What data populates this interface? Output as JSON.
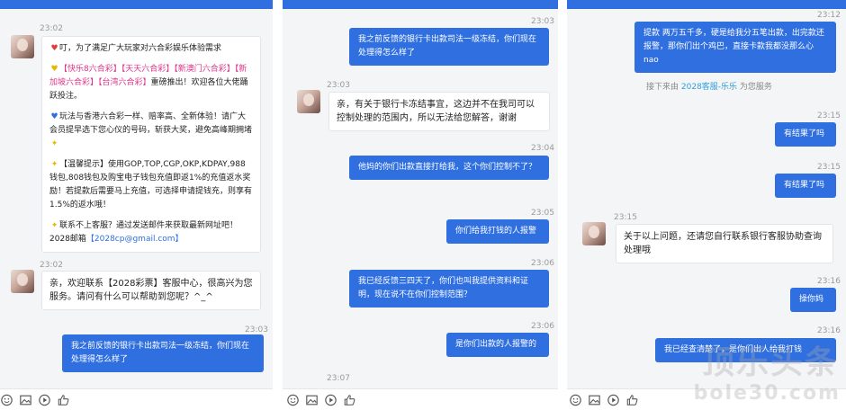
{
  "panel1": {
    "ts1": "23:02",
    "promo": {
      "line1": "叮，为了满足广大玩家对六合彩娱乐体验需求",
      "products_a": "【快乐8六合彩】【天天六合彩】【新澳门六合彩】",
      "products_b": "【新加坡六合彩】【台湾六合彩】",
      "line2_tail": "重磅推出！欢迎各位大佬踊跃投注。",
      "line3": "玩法与香港六合彩一样、赔率高、全新体验！请广大会员提早选下您心仪的号码，斩获大奖，避免高峰期拥堵",
      "line4": "【温馨提示】使用GOP,TOP,CGP,OKP,KDPAY,988钱包,808钱包及购宝电子钱包充值即返1%的充值返水奖励！若提款后需要马上充值，可选择申请提钱充，则享有1.5%的返水哦！",
      "line5": "联系不上客服？通过发送邮件来获取最新网址吧！2028邮箱",
      "email": "【2028cp@gmail.com】"
    },
    "ts2": "23:02",
    "greet": "亲，欢迎联系【2028彩票】客服中心，很高兴为您服务。请问有什么可以帮助到您呢？^_^",
    "ts3": "23:03",
    "q1": "我之前反馈的银行卡出款司法一级冻结，你们现在处理得怎么样了"
  },
  "panel2": {
    "ts1": "23:03",
    "q1": "我之前反馈的银行卡出款司法一级冻结，你们现在处理得怎么样了",
    "ts2": "23:03",
    "a1": "亲，有关于银行卡冻结事宜，这边并不在我司可以控制处理的范围内，所以无法给您解答，谢谢",
    "ts3": "23:04",
    "q2": "他妈的你们出款直接打给我，这个你们控制不了？",
    "ts4": "23:05",
    "q3": "你们给我打钱的人报警",
    "ts5": "23:06",
    "q4": "我已经反馈三四天了，你们也叫我提供资料和证明，现在说不在你们控制范围？",
    "ts6": "23:06",
    "q5": "是你们出款的人报警的",
    "ts7": "23:07"
  },
  "panel3": {
    "ts1": "23:12",
    "q1": "提款 两万五千多，硬是给我分五笔出款，出完款还报警，那你们出个鸡巴，直接卡款我都没那么心nao",
    "transfer_prefix": "接下来由",
    "transfer_agent": "2028客服-乐乐",
    "transfer_suffix": "为您服务",
    "ts2": "23:15",
    "q2": "有结果了吗",
    "ts3": "23:15",
    "q3": "有结果了吗",
    "ts4": "23:15",
    "a1": "关于以上问题，还请您自行联系银行客服协助查询处理哦",
    "ts5": "23:16",
    "q4": "操你妈",
    "ts6": "23:16",
    "q5": "我已经查清楚了，是你们出人给我打钱",
    "watermark_big": "顶乐头条",
    "watermark_small": "bole30.com"
  },
  "toolbar_icons": [
    "emoji-icon",
    "image-icon",
    "video-icon",
    "thumbs-up-icon"
  ],
  "colors": {
    "accent": "#2f6fe0",
    "pink": "#e0338c",
    "background": "#f4f5f7"
  }
}
